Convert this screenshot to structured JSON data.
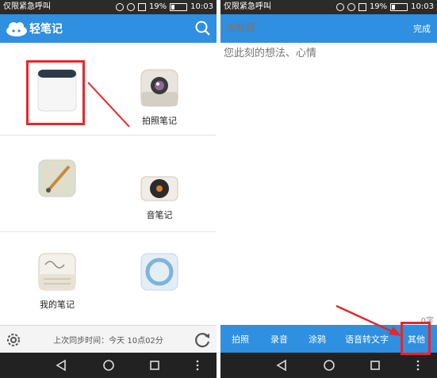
{
  "status": {
    "carrier": "仅限紧急呼叫",
    "battery": "19%",
    "time": "10:03",
    "battery_level": 0.19
  },
  "home": {
    "app_title": "轻笔记",
    "items": [
      {
        "label": ""
      },
      {
        "label": "拍照笔记"
      },
      {
        "label": ""
      },
      {
        "label": "音笔记"
      },
      {
        "label": "我的笔记"
      },
      {
        "label": ""
      }
    ],
    "sync_text": "上次同步时间：今天 10点02分"
  },
  "editor": {
    "title_placeholder": "无标题",
    "body_placeholder": "您此刻的想法、心情",
    "done_label": "完成",
    "count": "0字",
    "tools": [
      "拍照",
      "录音",
      "涂鸦",
      "语音转文字",
      "其他"
    ]
  },
  "colors": {
    "accent": "#2f8fe0",
    "annotation": "#e8262a"
  }
}
